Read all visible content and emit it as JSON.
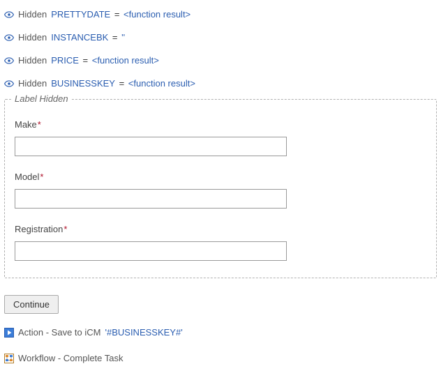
{
  "hidden_fields": [
    {
      "name": "PRETTYDATE",
      "value_kind": "func",
      "value": "<function result>"
    },
    {
      "name": "INSTANCEBK",
      "value_kind": "str",
      "value": " '' "
    },
    {
      "name": "PRICE",
      "value_kind": "func",
      "value": "<function result>"
    },
    {
      "name": "BUSINESSKEY",
      "value_kind": "func",
      "value": "<function result>"
    }
  ],
  "hidden_word": "Hidden",
  "group": {
    "legend": "Label Hidden",
    "fields": [
      {
        "label": "Make",
        "required": true
      },
      {
        "label": "Model",
        "required": true
      },
      {
        "label": "Registration",
        "required": true
      }
    ]
  },
  "continue_label": "Continue",
  "action": {
    "lead": "Action - Save to iCM",
    "param": "'#BUSINESSKEY#'"
  },
  "workflow": {
    "lead": "Workflow - Complete Task"
  },
  "asterisk": "*",
  "equals": " = "
}
